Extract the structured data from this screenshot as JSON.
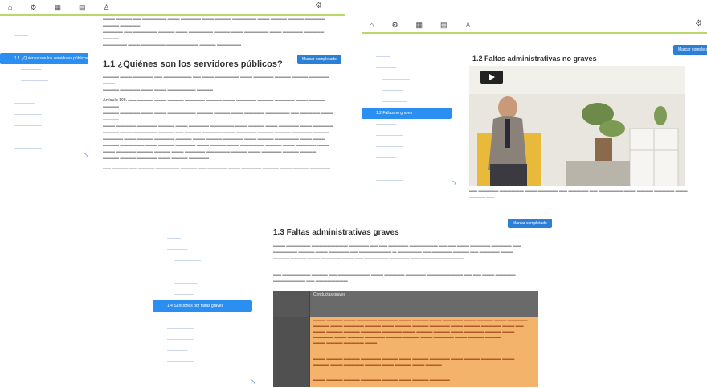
{
  "toolbar": {
    "items": [
      "home-icon",
      "gear-icon",
      "grid-icon",
      "document-icon",
      "user-icon"
    ],
    "right_icon": "settings-icon"
  },
  "panel1": {
    "sidebar": [
      {
        "label": "",
        "active": false
      },
      {
        "label": "",
        "active": false
      },
      {
        "label": "1.1 ¿Quiénes son los servidores públicos?",
        "active": true
      }
    ],
    "heading": "1.1 ¿Quiénes son los servidores públicos?",
    "btn": "Marcar completado",
    "para_lead": "Artículo 108."
  },
  "panel2": {
    "heading": "1.2 Faltas administrativas no graves",
    "btn": "Marcar completado",
    "sidebar_active": "1.2 Faltas no graves"
  },
  "panel3": {
    "heading": "1.3 Faltas administrativas graves",
    "btn": "Marcar completado",
    "sidebar_active": "1.4 Sanciones por faltas graves",
    "table_header": "Conductas graves"
  }
}
